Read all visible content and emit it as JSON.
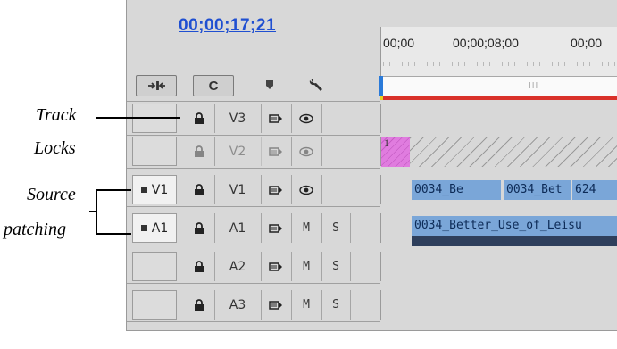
{
  "timecode": "00;00;17;21",
  "ruler": {
    "labels": [
      "00;00",
      "00;00;08;00",
      "00;00"
    ]
  },
  "scroll_grip": "III",
  "tools": [
    {
      "name": "insert-overwrite-icon"
    },
    {
      "name": "snap-icon",
      "glyph": "C"
    },
    {
      "name": "add-marker-icon"
    },
    {
      "name": "wrench-icon"
    }
  ],
  "annotations": {
    "track_locks_line1": "Track",
    "track_locks_line2": "Locks",
    "source_line1": "Source",
    "source_line2": "patching"
  },
  "tracks": [
    {
      "name": "V3",
      "source": "",
      "kind": "video",
      "dim": false
    },
    {
      "name": "V2",
      "source": "",
      "kind": "video",
      "dim": true
    },
    {
      "name": "V1",
      "source": "V1",
      "kind": "video",
      "dim": false
    },
    {
      "name": "A1",
      "source": "A1",
      "kind": "audio",
      "m": "M",
      "s": "S"
    },
    {
      "name": "A2",
      "source": "",
      "kind": "audio",
      "m": "M",
      "s": "S"
    },
    {
      "name": "A3",
      "source": "",
      "kind": "audio",
      "m": "M",
      "s": "S"
    }
  ],
  "clips": {
    "v2_label": "1",
    "v1": [
      "0034_Be",
      "0034_Bet",
      "624"
    ],
    "a1": "0034_Better_Use_of_Leisu"
  },
  "colors": {
    "timecode": "#1f4fd1",
    "video_clip": "#7aa6d8",
    "audio_clip_bar": "#2e3f5c",
    "marker_red": "#d9312a",
    "marker_yellow": "#e8d11c"
  }
}
